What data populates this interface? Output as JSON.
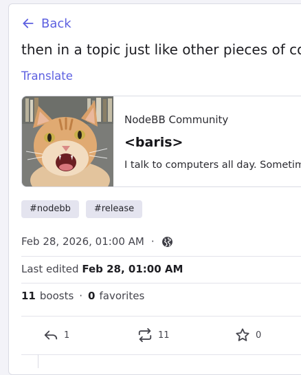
{
  "nav": {
    "back_label": "Back"
  },
  "post": {
    "text_fragment": "then in a topic just like other pieces of conte",
    "translate_label": "Translate"
  },
  "link_card": {
    "site_name": "NodeBB Community",
    "title": "<baris>",
    "description": "I talk to computers all day. Sometimes they listen."
  },
  "tags": [
    "#nodebb",
    "#release"
  ],
  "meta": {
    "date": "Feb 28, 2026, 01:00 AM",
    "dot": "·",
    "visibility_icon": "globe-icon",
    "edited_prefix": "Last edited",
    "edited_date": "Feb 28, 01:00 AM"
  },
  "stats": {
    "boosts_count": "11",
    "boosts_label": "boosts",
    "sep": "·",
    "favorites_count": "0",
    "favorites_label": "favorites"
  },
  "actions": {
    "reply_count": "1",
    "boost_count": "11",
    "favorite_count": "0"
  },
  "colors": {
    "accent": "#5c5fe0",
    "tag_bg": "#e4e4ef",
    "border": "#dadbe4"
  }
}
